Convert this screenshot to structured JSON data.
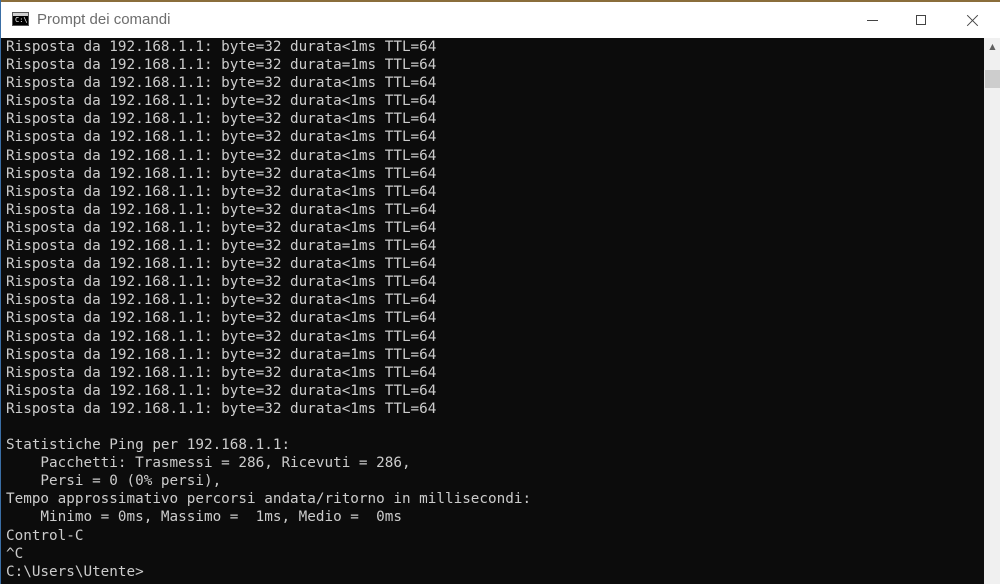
{
  "window": {
    "title": "Prompt dei comandi",
    "icon_label": "C:\\",
    "controls": {
      "minimize": "minimize-icon",
      "maximize": "maximize-icon",
      "close": "close-icon"
    }
  },
  "console": {
    "lines": [
      "Risposta da 192.168.1.1: byte=32 durata<1ms TTL=64",
      "Risposta da 192.168.1.1: byte=32 durata=1ms TTL=64",
      "Risposta da 192.168.1.1: byte=32 durata<1ms TTL=64",
      "Risposta da 192.168.1.1: byte=32 durata<1ms TTL=64",
      "Risposta da 192.168.1.1: byte=32 durata<1ms TTL=64",
      "Risposta da 192.168.1.1: byte=32 durata<1ms TTL=64",
      "Risposta da 192.168.1.1: byte=32 durata<1ms TTL=64",
      "Risposta da 192.168.1.1: byte=32 durata<1ms TTL=64",
      "Risposta da 192.168.1.1: byte=32 durata<1ms TTL=64",
      "Risposta da 192.168.1.1: byte=32 durata<1ms TTL=64",
      "Risposta da 192.168.1.1: byte=32 durata<1ms TTL=64",
      "Risposta da 192.168.1.1: byte=32 durata=1ms TTL=64",
      "Risposta da 192.168.1.1: byte=32 durata<1ms TTL=64",
      "Risposta da 192.168.1.1: byte=32 durata<1ms TTL=64",
      "Risposta da 192.168.1.1: byte=32 durata<1ms TTL=64",
      "Risposta da 192.168.1.1: byte=32 durata<1ms TTL=64",
      "Risposta da 192.168.1.1: byte=32 durata<1ms TTL=64",
      "Risposta da 192.168.1.1: byte=32 durata=1ms TTL=64",
      "Risposta da 192.168.1.1: byte=32 durata<1ms TTL=64",
      "Risposta da 192.168.1.1: byte=32 durata<1ms TTL=64",
      "Risposta da 192.168.1.1: byte=32 durata<1ms TTL=64",
      "",
      "Statistiche Ping per 192.168.1.1:",
      "    Pacchetti: Trasmessi = 286, Ricevuti = 286,",
      "    Persi = 0 (0% persi),",
      "Tempo approssimativo percorsi andata/ritorno in millisecondi:",
      "    Minimo = 0ms, Massimo =  1ms, Medio =  0ms",
      "Control-C",
      "^C",
      "C:\\Users\\Utente>"
    ]
  },
  "colors": {
    "console_bg": "#0c0c0c",
    "console_text": "#cccccc",
    "titlebar_bg": "#ffffff",
    "scrollbar_bg": "#f0f0f0",
    "scrollbar_thumb": "#cdcdcd"
  },
  "scrollbar": {
    "up_arrow": "▲"
  }
}
